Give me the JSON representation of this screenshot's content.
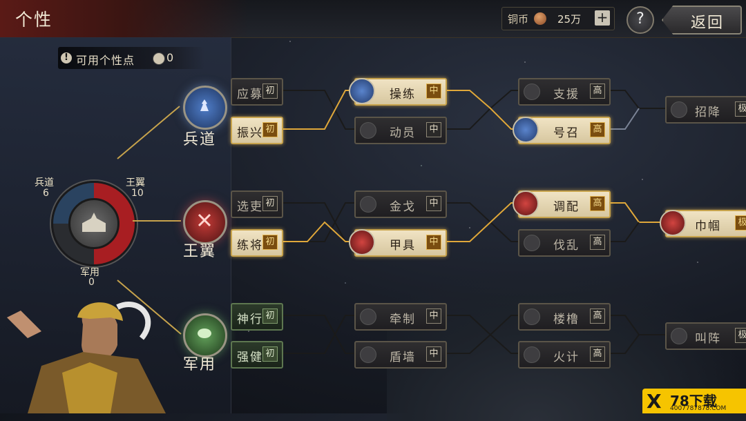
{
  "header": {
    "title": "个性",
    "currency_label": "铜币",
    "currency_icon": "copper-coin-icon",
    "currency_value": "25万",
    "plus_label": "+",
    "help_label": "?",
    "back_label": "返回"
  },
  "points": {
    "label": "可用个性点",
    "value": "0"
  },
  "stats": {
    "bingdao": {
      "label": "兵道",
      "value": "6"
    },
    "wangyi": {
      "label": "王翼",
      "value": "10"
    },
    "junyong": {
      "label": "军用",
      "value": "0"
    }
  },
  "branches": [
    {
      "label": "兵道",
      "icon": "soldier-icon"
    },
    {
      "label": "王翼",
      "icon": "crossed-swords-icon"
    },
    {
      "label": "军用",
      "icon": "leaf-icon"
    }
  ],
  "tree": {
    "col1": [
      {
        "name": "应募",
        "tier": "初"
      },
      {
        "name": "振兴",
        "tier": "初"
      },
      {
        "name": "选吏",
        "tier": "初"
      },
      {
        "name": "练将",
        "tier": "初"
      },
      {
        "name": "神行",
        "tier": "初"
      },
      {
        "name": "强健",
        "tier": "初"
      }
    ],
    "col2": [
      {
        "name": "操练",
        "tier": "中"
      },
      {
        "name": "动员",
        "tier": "中"
      },
      {
        "name": "金戈",
        "tier": "中"
      },
      {
        "name": "甲具",
        "tier": "中"
      },
      {
        "name": "牵制",
        "tier": "中"
      },
      {
        "name": "盾墙",
        "tier": "中"
      }
    ],
    "col3": [
      {
        "name": "支援",
        "tier": "高"
      },
      {
        "name": "号召",
        "tier": "高"
      },
      {
        "name": "调配",
        "tier": "高"
      },
      {
        "name": "伐乱",
        "tier": "高"
      },
      {
        "name": "楼橹",
        "tier": "高"
      },
      {
        "name": "火计",
        "tier": "高"
      }
    ],
    "col4": [
      {
        "name": "招降",
        "tier": "极"
      },
      {
        "name": "巾帼",
        "tier": "极"
      },
      {
        "name": "叫阵",
        "tier": "极"
      }
    ]
  },
  "watermark": {
    "x": "X",
    "brand": "78下载",
    "url": "4007787878.COM"
  }
}
